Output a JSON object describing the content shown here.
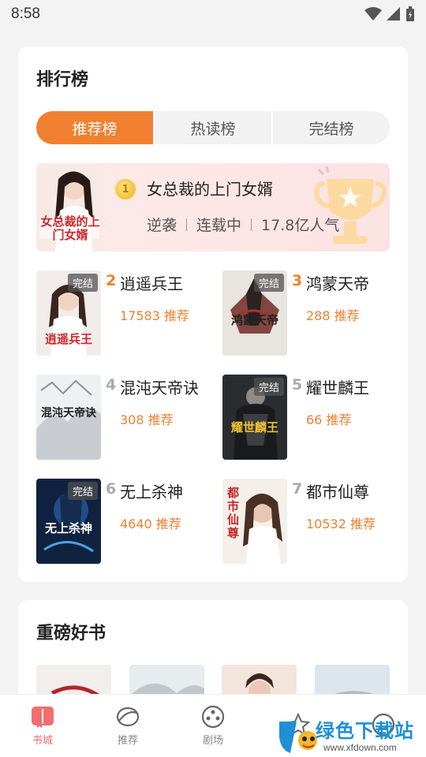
{
  "status": {
    "time": "8:58"
  },
  "ranking": {
    "title": "排行榜",
    "tabs": [
      {
        "label": "推荐榜",
        "active": true
      },
      {
        "label": "热读榜",
        "active": false
      },
      {
        "label": "完结榜",
        "active": false
      }
    ],
    "top": {
      "rank": "1",
      "title": "女总裁的上门女婿",
      "tag": "逆袭",
      "status": "连载中",
      "popularity": "17.8亿人气",
      "cover_text": "女总裁的上门女婿"
    },
    "books": [
      {
        "rank": "2",
        "title": "逍遥兵王",
        "rec": "17583 推荐",
        "badge": "完结",
        "cover_text": "逍遥兵王"
      },
      {
        "rank": "3",
        "title": "鸿蒙天帝",
        "rec": "288 推荐",
        "badge": "完结",
        "cover_text": "鸿蒙天帝"
      },
      {
        "rank": "4",
        "title": "混沌天帝诀",
        "rec": "308 推荐",
        "badge": "",
        "cover_text": "混沌天帝诀"
      },
      {
        "rank": "5",
        "title": "耀世麟王",
        "rec": "66 推荐",
        "badge": "完结",
        "cover_text": "耀世麟王"
      },
      {
        "rank": "6",
        "title": "无上杀神",
        "rec": "4640 推荐",
        "badge": "完结",
        "cover_text": "无上杀神"
      },
      {
        "rank": "7",
        "title": "都市仙尊",
        "rec": "10532 推荐",
        "badge": "",
        "cover_text": "都市仙尊"
      }
    ]
  },
  "heavy": {
    "title": "重磅好书"
  },
  "nav": [
    {
      "label": "书城",
      "icon": "book-icon",
      "active": true
    },
    {
      "label": "推荐",
      "icon": "recommend-icon",
      "active": false
    },
    {
      "label": "剧场",
      "icon": "theater-icon",
      "active": false
    },
    {
      "label": "",
      "icon": "star-icon",
      "active": false
    },
    {
      "label": "",
      "icon": "profile-icon",
      "active": false
    }
  ],
  "watermark": {
    "text": "绿色下载站",
    "url": "www.xfdown.com"
  },
  "colors": {
    "accent": "#f08030",
    "active_nav": "#f26d6d",
    "background": "#f3f3f3"
  }
}
